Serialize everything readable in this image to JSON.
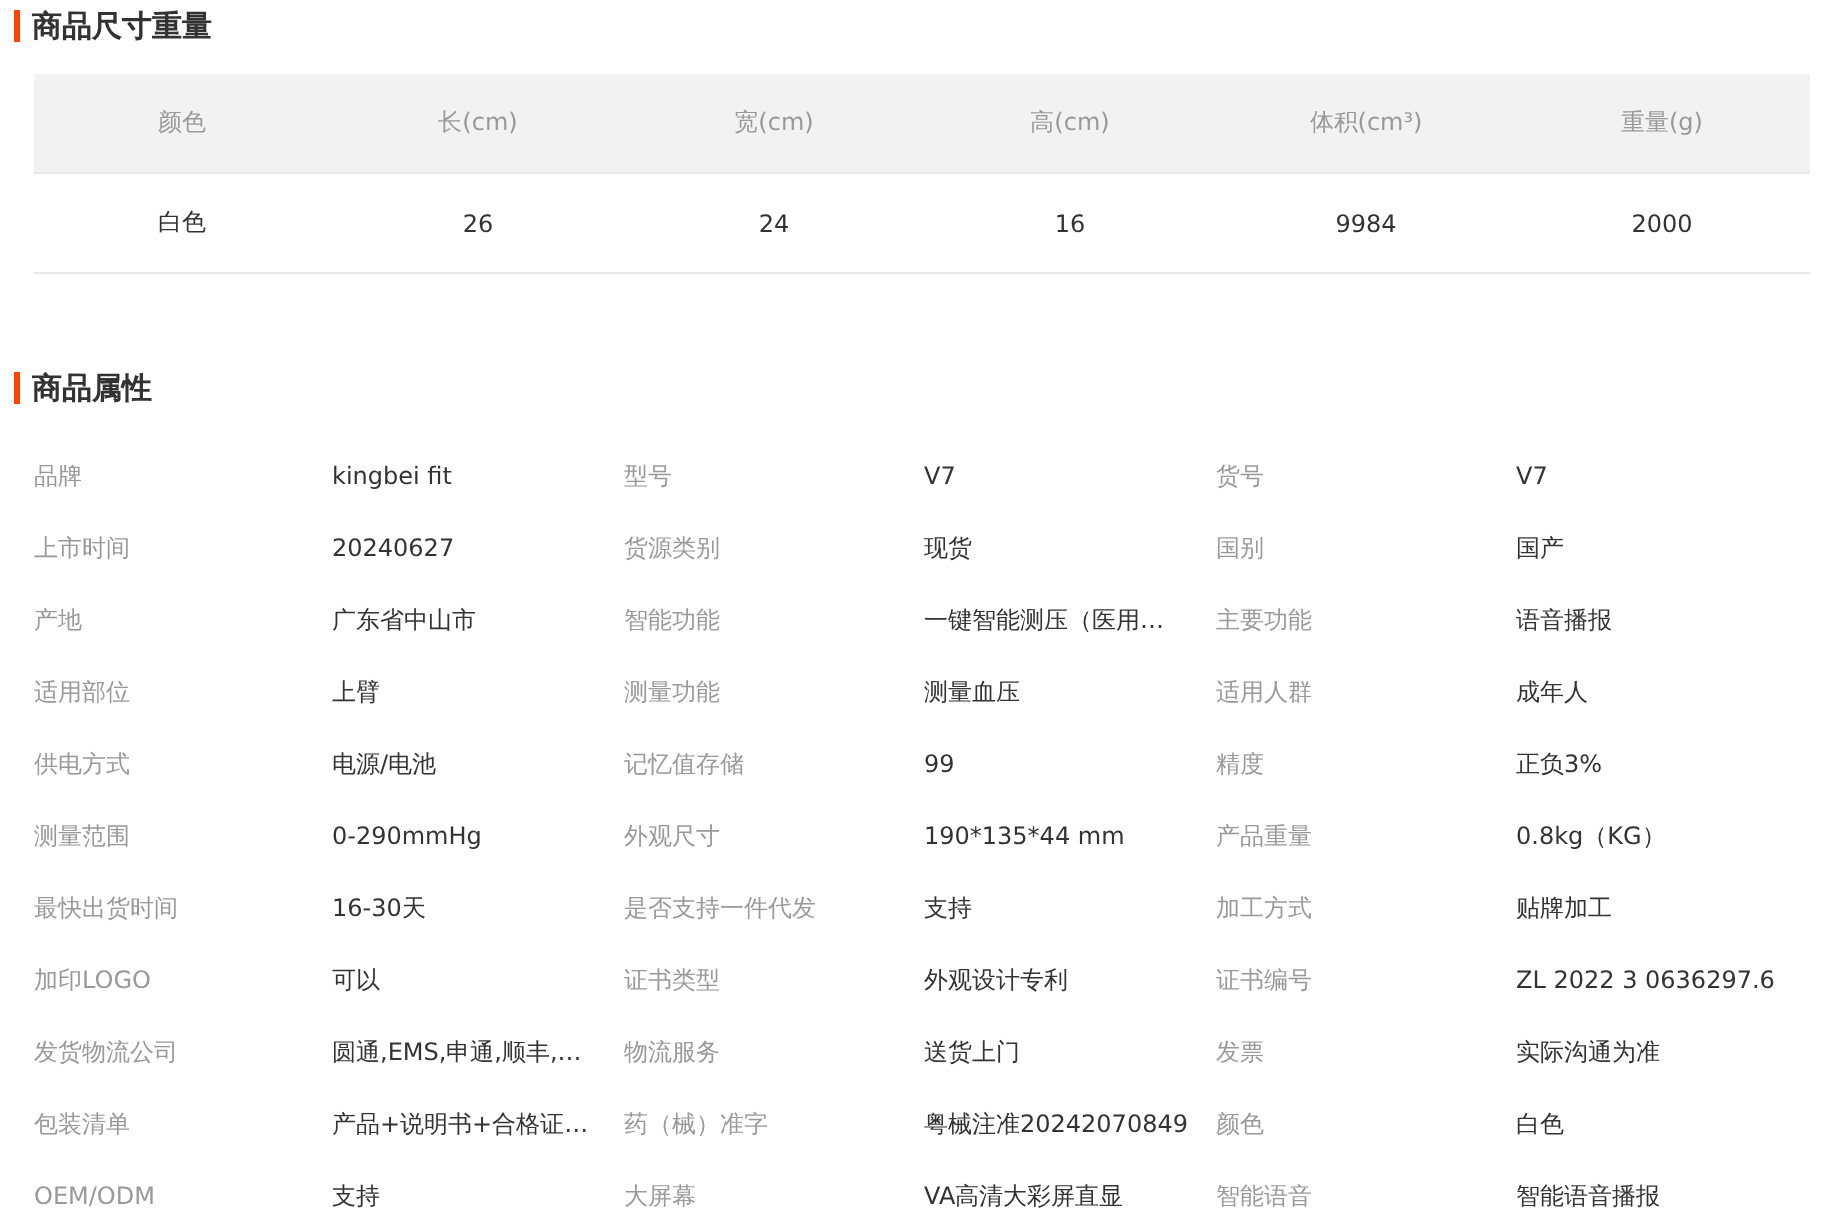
{
  "size_section": {
    "title": "商品尺寸重量",
    "table": {
      "columns": [
        "颜色",
        "长(cm)",
        "宽(cm)",
        "高(cm)",
        "体积(cm³)",
        "重量(g)"
      ],
      "rows": [
        [
          "白色",
          "26",
          "24",
          "16",
          "9984",
          "2000"
        ]
      ]
    }
  },
  "attributes_section": {
    "title": "商品属性",
    "items": [
      {
        "label": "品牌",
        "value": "kingbei fit"
      },
      {
        "label": "型号",
        "value": "V7"
      },
      {
        "label": "货号",
        "value": "V7"
      },
      {
        "label": "上市时间",
        "value": "20240627"
      },
      {
        "label": "货源类别",
        "value": "现货"
      },
      {
        "label": "国别",
        "value": "国产"
      },
      {
        "label": "产地",
        "value": "广东省中山市"
      },
      {
        "label": "智能功能",
        "value": "一键智能测压（医用…"
      },
      {
        "label": "主要功能",
        "value": "语音播报"
      },
      {
        "label": "适用部位",
        "value": "上臂"
      },
      {
        "label": "测量功能",
        "value": "测量血压"
      },
      {
        "label": "适用人群",
        "value": "成年人"
      },
      {
        "label": "供电方式",
        "value": "电源/电池"
      },
      {
        "label": "记忆值存储",
        "value": "99"
      },
      {
        "label": "精度",
        "value": "正负3%"
      },
      {
        "label": "测量范围",
        "value": "0-290mmHg"
      },
      {
        "label": "外观尺寸",
        "value": "190*135*44 mm"
      },
      {
        "label": "产品重量",
        "value": "0.8kg（KG）"
      },
      {
        "label": "最快出货时间",
        "value": "16-30天"
      },
      {
        "label": "是否支持一件代发",
        "value": "支持"
      },
      {
        "label": "加工方式",
        "value": "贴牌加工"
      },
      {
        "label": "加印LOGO",
        "value": "可以"
      },
      {
        "label": "证书类型",
        "value": "外观设计专利"
      },
      {
        "label": "证书编号",
        "value": "ZL 2022 3 0636297.6"
      },
      {
        "label": "发货物流公司",
        "value": "圆通,EMS,申通,顺丰,…"
      },
      {
        "label": "物流服务",
        "value": "送货上门"
      },
      {
        "label": "发票",
        "value": "实际沟通为准"
      },
      {
        "label": "包装清单",
        "value": "产品+说明书+合格证…"
      },
      {
        "label": "药（械）准字",
        "value": "粤械注准20242070849"
      },
      {
        "label": "颜色",
        "value": "白色"
      },
      {
        "label": "OEM/ODM",
        "value": "支持"
      },
      {
        "label": "大屏幕",
        "value": "VA高清大彩屏直显"
      },
      {
        "label": "智能语音",
        "value": "智能语音播报"
      }
    ]
  }
}
